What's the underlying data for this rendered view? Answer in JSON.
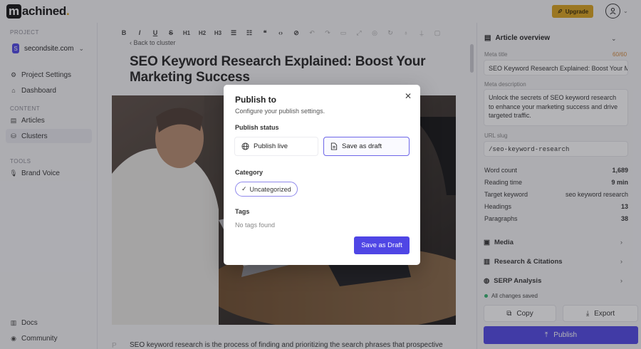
{
  "brand": {
    "logo_letter": "m",
    "logo_rest": "achined",
    "logo_dot": "."
  },
  "header": {
    "upgrade_label": "Upgrade"
  },
  "sidebar": {
    "project_title": "PROJECT",
    "site_initial": "S",
    "site_name": "secondsite.com",
    "project_items": [
      {
        "label": "Project Settings",
        "icon": "gear-icon"
      },
      {
        "label": "Dashboard",
        "icon": "home-icon"
      }
    ],
    "content_title": "CONTENT",
    "content_items": [
      {
        "label": "Articles",
        "icon": "article-icon"
      },
      {
        "label": "Clusters",
        "icon": "clusters-icon",
        "active": true
      }
    ],
    "tools_title": "TOOLS",
    "tools_items": [
      {
        "label": "Brand Voice",
        "icon": "mic-icon"
      }
    ],
    "footer_items": [
      {
        "label": "Docs",
        "icon": "book-icon"
      },
      {
        "label": "Community",
        "icon": "discord-icon"
      }
    ]
  },
  "editor": {
    "toolbar": [
      "B",
      "I",
      "U",
      "S",
      "H1",
      "H2",
      "H3",
      "ul",
      "ol",
      "99",
      "<>",
      "link",
      "undo",
      "redo",
      "img",
      "expand",
      "target",
      "refresh",
      "bulb",
      "mic",
      "box"
    ],
    "back_label": "Back to cluster",
    "title": "SEO Keyword Research Explained: Boost Your Marketing Success",
    "paragraph_marker": "P",
    "paragraph": "SEO keyword research is the process of finding and prioritizing the search phrases that prospective"
  },
  "panel": {
    "overview_label": "Article overview",
    "meta_title_label": "Meta title",
    "meta_title_count": "60/60",
    "meta_title_value": "SEO Keyword Research Explained: Boost Your Ma",
    "meta_description_label": "Meta description",
    "meta_description_value": "Unlock the secrets of SEO keyword research to enhance your marketing success and drive targeted traffic.",
    "url_slug_label": "URL slug",
    "url_slug_value": "/seo-keyword-research",
    "stats": [
      {
        "label": "Word count",
        "value": "1,689"
      },
      {
        "label": "Reading time",
        "value": "9 min"
      },
      {
        "label": "Target keyword",
        "value": "seo keyword research"
      },
      {
        "label": "Headings",
        "value": "13"
      },
      {
        "label": "Paragraphs",
        "value": "38"
      }
    ],
    "sections": [
      {
        "label": "Media",
        "icon": "image-icon"
      },
      {
        "label": "Research & Citations",
        "icon": "book-icon"
      },
      {
        "label": "SERP Analysis",
        "icon": "globe-icon"
      }
    ],
    "saved_label": "All changes saved",
    "copy_label": "Copy",
    "export_label": "Export",
    "publish_label": "Publish"
  },
  "modal": {
    "title": "Publish to",
    "subtitle": "Configure your publish settings.",
    "status_label": "Publish status",
    "option_live": "Publish live",
    "option_draft": "Save as draft",
    "category_label": "Category",
    "category_chip": "Uncategorized",
    "tags_label": "Tags",
    "tags_empty": "No tags found",
    "save_button": "Save as Draft"
  },
  "colors": {
    "accent": "#4f46e5",
    "upgrade": "#d9a21b",
    "saved": "#33b26d",
    "counter": "#d4893b"
  }
}
